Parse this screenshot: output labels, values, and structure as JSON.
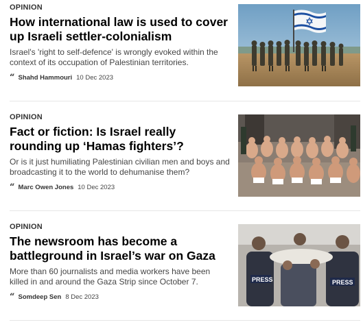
{
  "articles": [
    {
      "label": "OPINION",
      "headline": "How international law is used to cover up Israeli settler-colonialism",
      "summary": "Israel's 'right to self-defence' is wrongly evoked within the context of its occupation of Palestinian territories.",
      "author": "Shahd Hammouri",
      "date": "10 Dec 2023"
    },
    {
      "label": "OPINION",
      "headline": "Fact or fiction: Is Israel really rounding up ‘Hamas fighters’?",
      "summary": "Or is it just humiliating Palestinian civilian men and boys and broadcasting it to the world to dehumanise them?",
      "author": "Marc Owen Jones",
      "date": "10 Dec 2023"
    },
    {
      "label": "OPINION",
      "headline": "The newsroom has become a battleground in Israel’s war on Gaza",
      "summary": "More than 60 journalists and media workers have been killed in and around the Gaza Strip since October 7.",
      "author": "Somdeep Sen",
      "date": "8 Dec 2023"
    }
  ],
  "images": {
    "soldiers_flag_vest_text": "",
    "press_vest_text_1": "PRESS",
    "press_vest_text_2": "PRESS"
  },
  "colors": {
    "text": "#000000",
    "summary": "#444444",
    "divider": "#e6e6e6",
    "flag_blue": "#1c4fa1",
    "sky": "#8fb8d6",
    "sand": "#c9a877"
  },
  "icons": {
    "meta_quote": "quote-mark"
  }
}
